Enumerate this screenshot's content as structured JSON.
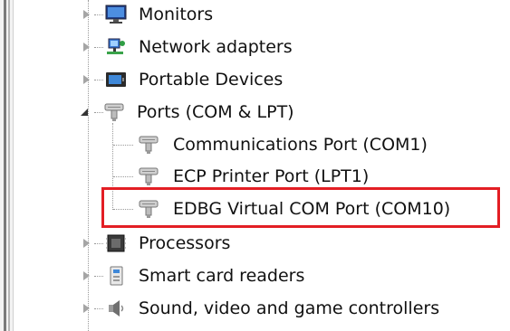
{
  "tree": {
    "items": [
      {
        "label": "Monitors",
        "icon": "monitor-icon",
        "state": "collapsed"
      },
      {
        "label": "Network adapters",
        "icon": "network-adapter-icon",
        "state": "collapsed"
      },
      {
        "label": "Portable Devices",
        "icon": "portable-device-icon",
        "state": "collapsed"
      },
      {
        "label": "Ports (COM & LPT)",
        "icon": "port-icon",
        "state": "expanded",
        "children": [
          {
            "label": "Communications Port (COM1)",
            "icon": "port-icon"
          },
          {
            "label": "ECP Printer Port (LPT1)",
            "icon": "port-icon"
          },
          {
            "label": "EDBG Virtual COM Port (COM10)",
            "icon": "port-icon",
            "highlighted": true
          }
        ]
      },
      {
        "label": "Processors",
        "icon": "processor-icon",
        "state": "collapsed"
      },
      {
        "label": "Smart card readers",
        "icon": "smart-card-reader-icon",
        "state": "collapsed"
      },
      {
        "label": "Sound, video and game controllers",
        "icon": "speaker-icon",
        "state": "collapsed"
      }
    ]
  },
  "colors": {
    "highlight_border": "#e31e24",
    "text": "#111111",
    "tree_lines": "#9a9a9a"
  }
}
